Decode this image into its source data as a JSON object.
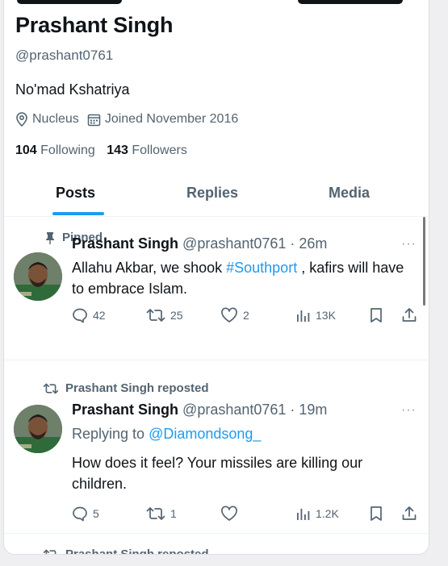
{
  "profile": {
    "name": "Prashant Singh",
    "handle": "@prashant0761",
    "bio": "No'mad Kshatriya",
    "location": "Nucleus",
    "joined": "Joined November 2016",
    "following_count": "104",
    "following_label": "Following",
    "followers_count": "143",
    "followers_label": "Followers"
  },
  "tabs": [
    {
      "label": "Posts",
      "active": true
    },
    {
      "label": "Replies",
      "active": false
    },
    {
      "label": "Media",
      "active": false
    }
  ],
  "posts": [
    {
      "context": "Pinned",
      "context_icon": "pin-icon",
      "name": "Prashant Singh",
      "handle_time": "@prashant0761 · 26m",
      "more": "···",
      "text_before": "Allahu Akbar, we shook ",
      "hashtag": "#Southport",
      "text_after": " , kafirs will have to embrace Islam.",
      "replies": "42",
      "reposts": "25",
      "likes": "2",
      "views": "13K"
    },
    {
      "context": "Prashant Singh reposted",
      "context_icon": "repost-icon",
      "name": "Prashant Singh",
      "handle_time": "@prashant0761 · 19m",
      "more": "···",
      "replying_prefix": "Replying to ",
      "replying_to": "@Diamondsong_",
      "text": "How does it feel? Your missiles are killing our children.",
      "replies": "5",
      "reposts": "1",
      "likes": "",
      "views": "1.2K"
    }
  ],
  "next_context": "Prashant Singh reposted",
  "colors": {
    "accent": "#1d9bf0",
    "muted": "#536471",
    "text": "#0f1419"
  }
}
